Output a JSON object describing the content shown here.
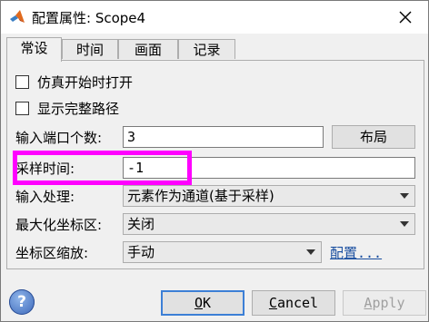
{
  "window": {
    "title": "配置属性: Scope4"
  },
  "tabs": [
    {
      "label": "常设"
    },
    {
      "label": "时间"
    },
    {
      "label": "画面"
    },
    {
      "label": "记录"
    }
  ],
  "main": {
    "open_at_sim_start": {
      "label": "仿真开始时打开",
      "checked": false
    },
    "show_full_path": {
      "label": "显示完整路径",
      "checked": false
    },
    "num_input_ports": {
      "label": "输入端口个数:",
      "value": "3",
      "layout_button": "布局"
    },
    "sample_time": {
      "label": "采样时间:",
      "value": "-1"
    },
    "input_processing": {
      "label": "输入处理:",
      "selected": "元素作为通道(基于采样)"
    },
    "maximize_axes": {
      "label": "最大化坐标区:",
      "selected": "关闭"
    },
    "axes_scaling": {
      "label": "坐标区缩放:",
      "selected": "手动",
      "config_link": "配置..."
    }
  },
  "footer": {
    "ok": {
      "mnemonic": "O",
      "rest": "K"
    },
    "cancel": {
      "mnemonic": "C",
      "rest": "ancel"
    },
    "apply": {
      "mnemonic": "A",
      "rest": "pply"
    }
  },
  "colors": {
    "highlight": "#ff00ff",
    "link": "#1a4fa0",
    "ok_border": "#3c7fd6"
  }
}
